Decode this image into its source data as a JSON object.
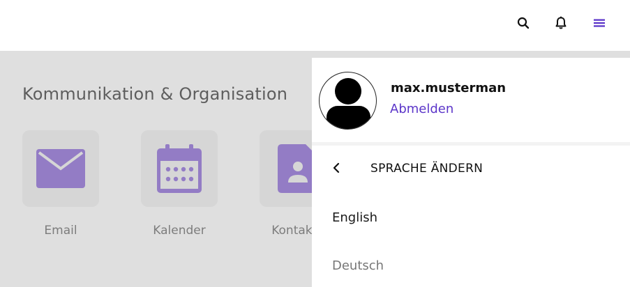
{
  "topbar": {
    "icons": [
      "search-icon",
      "bell-icon",
      "menu-icon"
    ],
    "accent_color": "#5b35c9"
  },
  "main": {
    "section_title": "Kommunikation & Organisation",
    "tiles": [
      {
        "label": "Email",
        "icon": "envelope-icon"
      },
      {
        "label": "Kalender",
        "icon": "calendar-icon"
      },
      {
        "label": "Kontakte",
        "icon": "contact-card-icon"
      }
    ],
    "icon_color": "#8c6ad8"
  },
  "user_panel": {
    "username": "max.musterman",
    "logout_label": "Abmelden",
    "language_menu": {
      "title": "SPRACHE ÄNDERN",
      "options": [
        "English",
        "Deutsch"
      ]
    }
  }
}
